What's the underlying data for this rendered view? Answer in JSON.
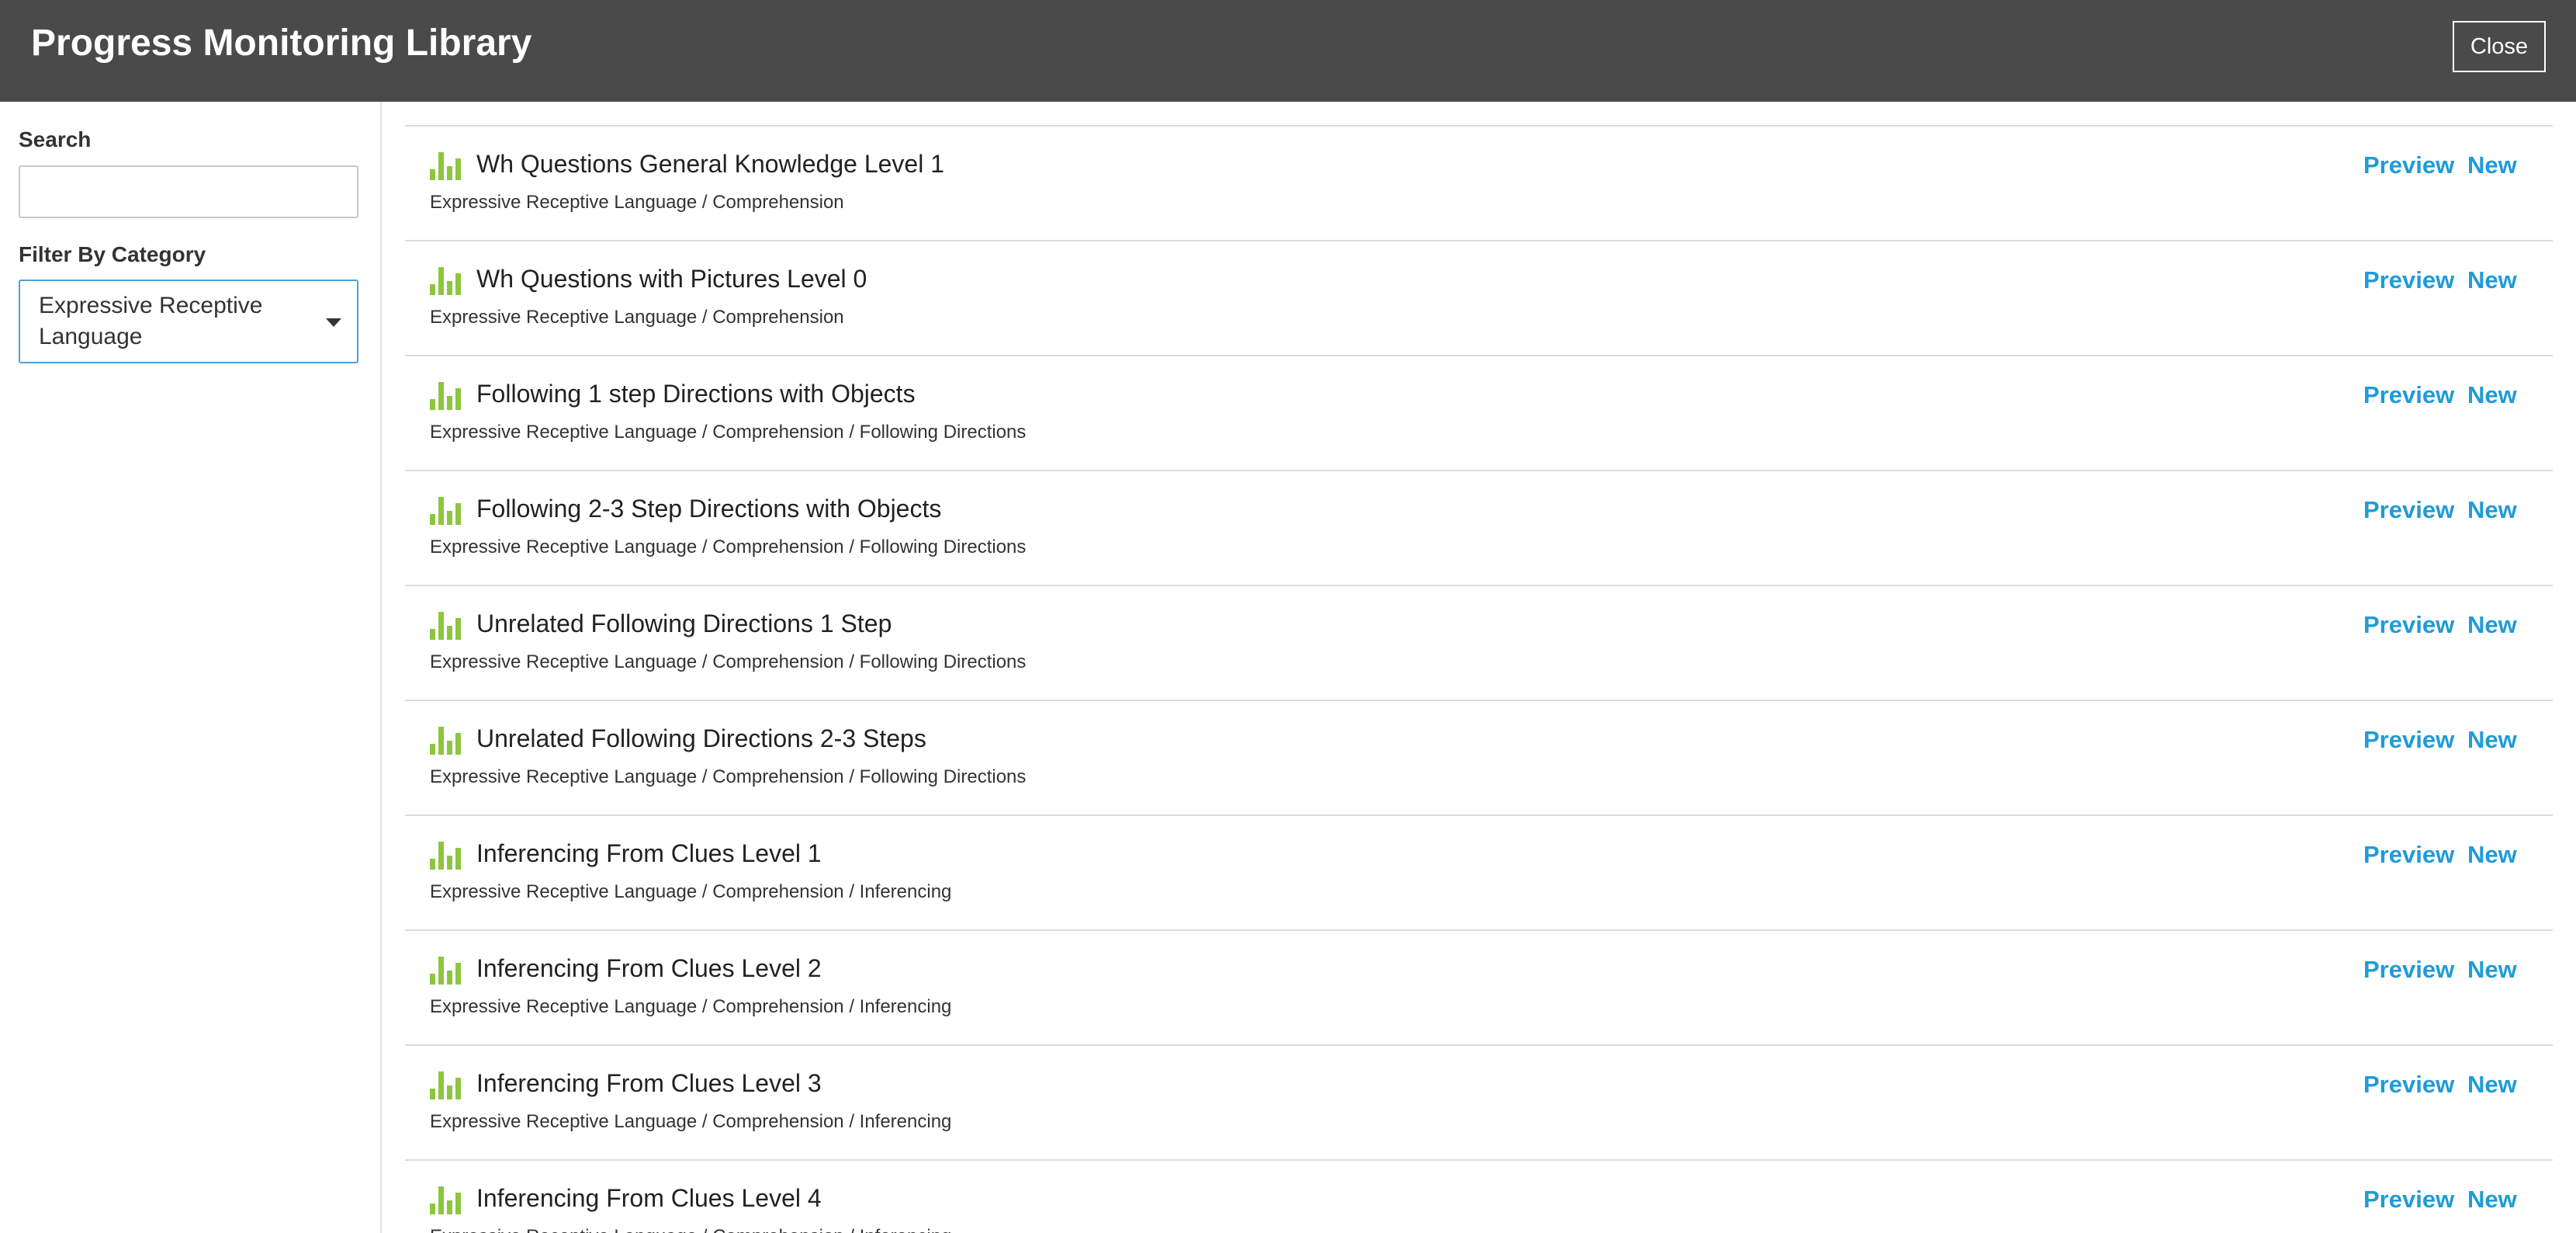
{
  "header": {
    "title": "Progress Monitoring Library",
    "close_label": "Close"
  },
  "sidebar": {
    "search_label": "Search",
    "search_value": "",
    "filter_label": "Filter By Category",
    "filter_selected": "Expressive Receptive Language"
  },
  "colors": {
    "accent": "#1f9bd7",
    "icon_green": "#8cc63f",
    "header_bg": "#4a4a4a",
    "select_border": "#4aa3df"
  },
  "item_icon": "bar-chart-icon",
  "items": [
    {
      "title": "Wh Questions General Knowledge Level 1",
      "path": "Expressive Receptive Language / Comprehension",
      "preview": "Preview",
      "new": "New"
    },
    {
      "title": "Wh Questions with Pictures Level 0",
      "path": "Expressive Receptive Language / Comprehension",
      "preview": "Preview",
      "new": "New"
    },
    {
      "title": "Following 1 step Directions with Objects",
      "path": "Expressive Receptive Language / Comprehension / Following Directions",
      "preview": "Preview",
      "new": "New"
    },
    {
      "title": "Following 2-3 Step Directions with Objects",
      "path": "Expressive Receptive Language / Comprehension / Following Directions",
      "preview": "Preview",
      "new": "New"
    },
    {
      "title": "Unrelated Following Directions 1 Step",
      "path": "Expressive Receptive Language / Comprehension / Following Directions",
      "preview": "Preview",
      "new": "New"
    },
    {
      "title": "Unrelated Following Directions 2-3 Steps",
      "path": "Expressive Receptive Language / Comprehension / Following Directions",
      "preview": "Preview",
      "new": "New"
    },
    {
      "title": "Inferencing From Clues Level 1",
      "path": "Expressive Receptive Language / Comprehension / Inferencing",
      "preview": "Preview",
      "new": "New"
    },
    {
      "title": "Inferencing From Clues Level 2",
      "path": "Expressive Receptive Language / Comprehension / Inferencing",
      "preview": "Preview",
      "new": "New"
    },
    {
      "title": "Inferencing From Clues Level 3",
      "path": "Expressive Receptive Language / Comprehension / Inferencing",
      "preview": "Preview",
      "new": "New"
    },
    {
      "title": "Inferencing From Clues Level 4",
      "path": "Expressive Receptive Language / Comprehension / Inferencing",
      "preview": "Preview",
      "new": "New"
    }
  ]
}
